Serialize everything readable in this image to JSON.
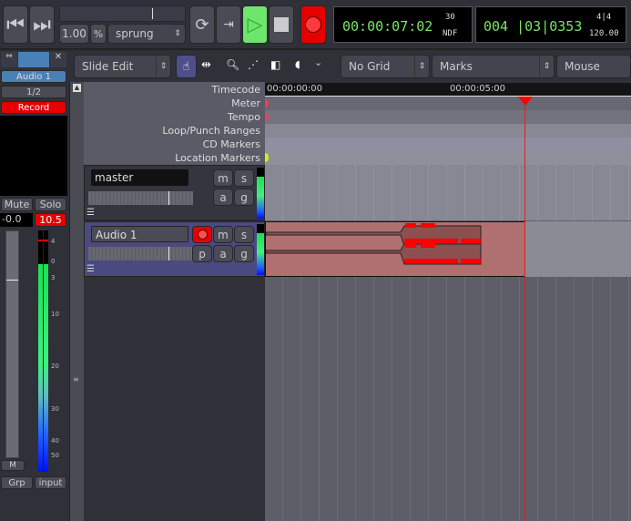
{
  "transport": {
    "shuttle_speed": "1.00",
    "shuttle_unit": "%",
    "shuttle_mode": "sprung"
  },
  "clocks": {
    "primary": {
      "value": "00:00:07:02",
      "fps": "30",
      "mode": "NDF"
    },
    "secondary": {
      "value": "004 |03|0353",
      "meter": "4|4",
      "tempo": "120.00"
    }
  },
  "toolbar": {
    "edit_mode": "Slide Edit",
    "grid": "No Grid",
    "snap": "Marks",
    "edit_point": "Mouse"
  },
  "rulers": {
    "labels": [
      "Timecode",
      "Meter",
      "Tempo",
      "Loop/Punch Ranges",
      "CD Markers",
      "Location Markers"
    ],
    "timecode_ticks": [
      "00:00:00:00",
      "00:00:05:00"
    ]
  },
  "tracks": [
    {
      "name": "master",
      "buttons": [
        "m",
        "s",
        "a",
        "g"
      ]
    },
    {
      "name": "Audio 1",
      "buttons": [
        "m",
        "s",
        "p",
        "a",
        "g"
      ]
    }
  ],
  "strip": {
    "name": "Audio 1",
    "input": "1/2",
    "record": "Record",
    "mute": "Mute",
    "solo": "Solo",
    "gain": "-0.0",
    "peak": "10.5",
    "meter_scale": [
      "4",
      "0",
      "3",
      "10",
      "20",
      "30",
      "40",
      "50"
    ],
    "m_button": "M",
    "group": "Grp",
    "input_button": "input"
  },
  "colors": {
    "record": "#e60000",
    "play": "#6ee66e",
    "clock_text": "#7be36b",
    "region": "#b07070",
    "playhead": "#e02020",
    "selected_track": "#4a4a80"
  }
}
